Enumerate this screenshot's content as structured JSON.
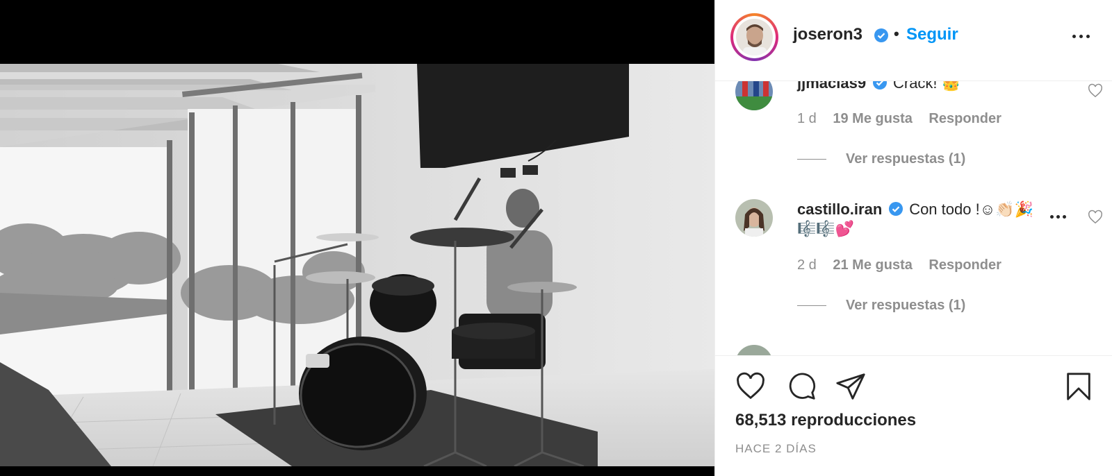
{
  "header": {
    "username": "joseron3",
    "separator": "•",
    "follow_label": "Seguir"
  },
  "comments": [
    {
      "username": "jjmacias9",
      "text": "Crack! 👑",
      "age": "1 d",
      "likes": "19 Me gusta",
      "reply_label": "Responder",
      "view_replies": "Ver respuestas (1)"
    },
    {
      "username": "castillo.iran",
      "text": "Con todo !☺👏🏻🎉",
      "text_line2": "🎼🎼💕",
      "age": "2 d",
      "likes": "21 Me gusta",
      "reply_label": "Responder",
      "view_replies": "Ver respuestas (1)"
    }
  ],
  "footer": {
    "views": "68,513 reproducciones",
    "date": "HACE 2 DÍAS"
  },
  "colors": {
    "accent": "#0095f6",
    "verified": "#3897f0",
    "muted": "#8e8e8e",
    "text": "#262626"
  },
  "icons": {
    "like": "heart-icon",
    "comment": "comment-icon",
    "share": "share-icon",
    "save": "bookmark-icon",
    "options": "more-options-icon",
    "verified": "verified-badge-icon"
  }
}
